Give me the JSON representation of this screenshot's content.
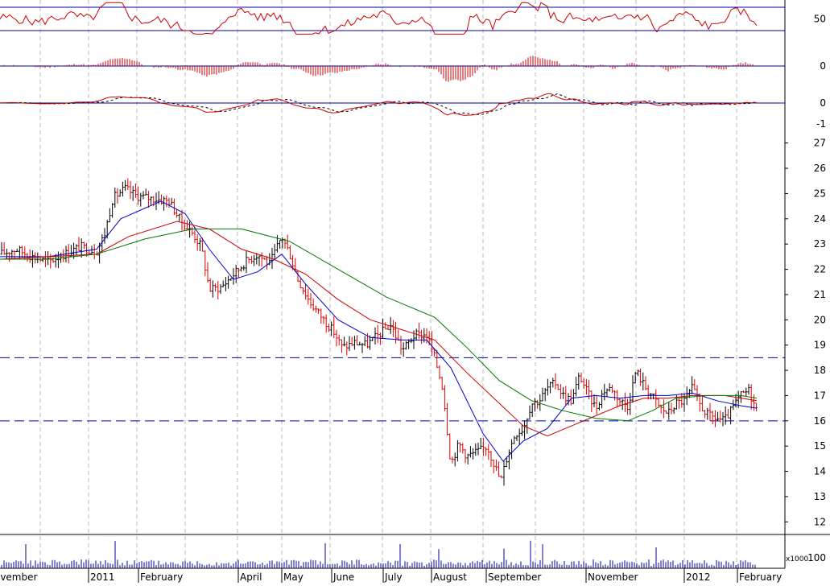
{
  "chart_data": [
    {
      "type": "line",
      "panel": "oscillator",
      "tick_labels": [
        "50"
      ],
      "reference_lines": [
        60,
        40
      ],
      "colors": {
        "line": "#cc0000",
        "reference": "#0000aa"
      }
    },
    {
      "type": "bar",
      "panel": "histogram",
      "tick_labels": [
        "0"
      ],
      "colors": {
        "bars": "#cc0000",
        "zero": "#0000aa"
      }
    },
    {
      "type": "line",
      "panel": "macd",
      "tick_labels": [
        "0",
        "-1"
      ],
      "series": [
        {
          "style": "solid",
          "color": "#cc0000"
        },
        {
          "style": "dashed",
          "color": "#000000"
        }
      ]
    },
    {
      "type": "candlestick",
      "panel": "price",
      "ylim": [
        11.5,
        27.5
      ],
      "y_ticks": [
        27,
        26,
        25,
        24,
        23,
        22,
        21,
        20,
        19,
        18,
        17,
        16,
        15,
        14,
        13,
        12
      ],
      "y_tick_labels": [
        "27",
        "26",
        "25",
        "24",
        "23",
        "22",
        "21",
        "20",
        "19",
        "18",
        "17",
        "16",
        "15",
        "14",
        "13",
        "12"
      ],
      "horizontal_levels": [
        18.5,
        16.0
      ],
      "months": [
        "November",
        "2011",
        "February",
        "April",
        "May",
        "June",
        "July",
        "August",
        "September",
        "November",
        "2012",
        "February"
      ],
      "close_series": [
        {
          "x": 0,
          "y": 22.6
        },
        {
          "x": 20,
          "y": 22.8
        },
        {
          "x": 40,
          "y": 22.5
        },
        {
          "x": 60,
          "y": 22.3
        },
        {
          "x": 80,
          "y": 22.6
        },
        {
          "x": 100,
          "y": 22.9
        },
        {
          "x": 120,
          "y": 22.7
        },
        {
          "x": 130,
          "y": 23.4
        },
        {
          "x": 140,
          "y": 24.8
        },
        {
          "x": 155,
          "y": 25.2
        },
        {
          "x": 170,
          "y": 24.9
        },
        {
          "x": 190,
          "y": 24.8
        },
        {
          "x": 210,
          "y": 24.7
        },
        {
          "x": 225,
          "y": 23.9
        },
        {
          "x": 240,
          "y": 23.4
        },
        {
          "x": 250,
          "y": 22.9
        },
        {
          "x": 260,
          "y": 21.2
        },
        {
          "x": 275,
          "y": 21.3
        },
        {
          "x": 290,
          "y": 21.8
        },
        {
          "x": 305,
          "y": 22.3
        },
        {
          "x": 320,
          "y": 22.6
        },
        {
          "x": 335,
          "y": 22.2
        },
        {
          "x": 350,
          "y": 23.3
        },
        {
          "x": 360,
          "y": 22.6
        },
        {
          "x": 370,
          "y": 21.6
        },
        {
          "x": 385,
          "y": 20.7
        },
        {
          "x": 400,
          "y": 20.1
        },
        {
          "x": 415,
          "y": 19.5
        },
        {
          "x": 425,
          "y": 18.9
        },
        {
          "x": 440,
          "y": 19.1
        },
        {
          "x": 455,
          "y": 19.0
        },
        {
          "x": 470,
          "y": 19.4
        },
        {
          "x": 485,
          "y": 19.8
        },
        {
          "x": 500,
          "y": 18.8
        },
        {
          "x": 515,
          "y": 19.4
        },
        {
          "x": 530,
          "y": 19.4
        },
        {
          "x": 540,
          "y": 18.5
        },
        {
          "x": 550,
          "y": 17.3
        },
        {
          "x": 560,
          "y": 14.3
        },
        {
          "x": 570,
          "y": 15.1
        },
        {
          "x": 580,
          "y": 14.6
        },
        {
          "x": 595,
          "y": 14.8
        },
        {
          "x": 605,
          "y": 15.0
        },
        {
          "x": 615,
          "y": 14.2
        },
        {
          "x": 622,
          "y": 13.6
        },
        {
          "x": 630,
          "y": 14.6
        },
        {
          "x": 640,
          "y": 15.5
        },
        {
          "x": 650,
          "y": 15.7
        },
        {
          "x": 660,
          "y": 16.7
        },
        {
          "x": 670,
          "y": 16.8
        },
        {
          "x": 680,
          "y": 17.3
        },
        {
          "x": 690,
          "y": 17.5
        },
        {
          "x": 700,
          "y": 17.0
        },
        {
          "x": 710,
          "y": 16.8
        },
        {
          "x": 720,
          "y": 17.8
        },
        {
          "x": 730,
          "y": 17.1
        },
        {
          "x": 740,
          "y": 16.5
        },
        {
          "x": 750,
          "y": 17.2
        },
        {
          "x": 760,
          "y": 17.3
        },
        {
          "x": 770,
          "y": 16.8
        },
        {
          "x": 780,
          "y": 16.6
        },
        {
          "x": 790,
          "y": 18.0
        },
        {
          "x": 800,
          "y": 17.4
        },
        {
          "x": 810,
          "y": 17.0
        },
        {
          "x": 820,
          "y": 16.5
        },
        {
          "x": 830,
          "y": 16.3
        },
        {
          "x": 840,
          "y": 16.7
        },
        {
          "x": 850,
          "y": 16.8
        },
        {
          "x": 860,
          "y": 17.3
        },
        {
          "x": 870,
          "y": 16.6
        },
        {
          "x": 880,
          "y": 16.2
        },
        {
          "x": 890,
          "y": 16.1
        },
        {
          "x": 900,
          "y": 16.0
        },
        {
          "x": 910,
          "y": 16.5
        },
        {
          "x": 920,
          "y": 17.0
        },
        {
          "x": 930,
          "y": 17.2
        },
        {
          "x": 940,
          "y": 16.4
        }
      ],
      "moving_averages": [
        {
          "color": "#0000cc",
          "points": [
            [
              0,
              22.5
            ],
            [
              60,
              22.5
            ],
            [
              120,
              22.8
            ],
            [
              150,
              24.0
            ],
            [
              200,
              24.7
            ],
            [
              230,
              24.2
            ],
            [
              260,
              22.8
            ],
            [
              290,
              21.6
            ],
            [
              320,
              21.9
            ],
            [
              350,
              22.6
            ],
            [
              380,
              21.4
            ],
            [
              420,
              20.0
            ],
            [
              460,
              19.3
            ],
            [
              500,
              19.2
            ],
            [
              530,
              19.2
            ],
            [
              560,
              18.1
            ],
            [
              600,
              15.5
            ],
            [
              625,
              14.4
            ],
            [
              650,
              15.2
            ],
            [
              680,
              15.7
            ],
            [
              710,
              16.9
            ],
            [
              740,
              17.0
            ],
            [
              770,
              16.9
            ],
            [
              800,
              17.0
            ],
            [
              830,
              17.0
            ],
            [
              860,
              17.1
            ],
            [
              890,
              16.8
            ],
            [
              920,
              16.6
            ],
            [
              940,
              16.5
            ]
          ]
        },
        {
          "color": "#cc0000",
          "points": [
            [
              0,
              22.4
            ],
            [
              60,
              22.5
            ],
            [
              120,
              22.6
            ],
            [
              160,
              23.3
            ],
            [
              220,
              23.9
            ],
            [
              260,
              23.6
            ],
            [
              300,
              22.8
            ],
            [
              340,
              22.4
            ],
            [
              380,
              21.8
            ],
            [
              420,
              20.8
            ],
            [
              460,
              20.0
            ],
            [
              500,
              19.6
            ],
            [
              540,
              19.2
            ],
            [
              580,
              17.9
            ],
            [
              620,
              16.7
            ],
            [
              650,
              15.8
            ],
            [
              680,
              15.4
            ],
            [
              710,
              15.8
            ],
            [
              740,
              16.2
            ],
            [
              770,
              16.6
            ],
            [
              800,
              16.9
            ],
            [
              830,
              16.9
            ],
            [
              860,
              17.0
            ],
            [
              900,
              17.0
            ],
            [
              940,
              16.8
            ]
          ]
        },
        {
          "color": "#007700",
          "points": [
            [
              0,
              22.4
            ],
            [
              60,
              22.4
            ],
            [
              120,
              22.6
            ],
            [
              180,
              23.2
            ],
            [
              240,
              23.6
            ],
            [
              300,
              23.6
            ],
            [
              360,
              23.1
            ],
            [
              420,
              22.0
            ],
            [
              480,
              20.9
            ],
            [
              540,
              20.1
            ],
            [
              580,
              18.9
            ],
            [
              620,
              17.6
            ],
            [
              660,
              16.8
            ],
            [
              700,
              16.4
            ],
            [
              740,
              16.1
            ],
            [
              780,
              16.0
            ],
            [
              810,
              16.4
            ],
            [
              840,
              16.9
            ],
            [
              880,
              17.0
            ],
            [
              920,
              17.0
            ],
            [
              940,
              16.9
            ]
          ]
        }
      ]
    },
    {
      "type": "bar",
      "panel": "volume",
      "tick_labels": [
        "100"
      ],
      "unit_label": "x1000"
    }
  ]
}
